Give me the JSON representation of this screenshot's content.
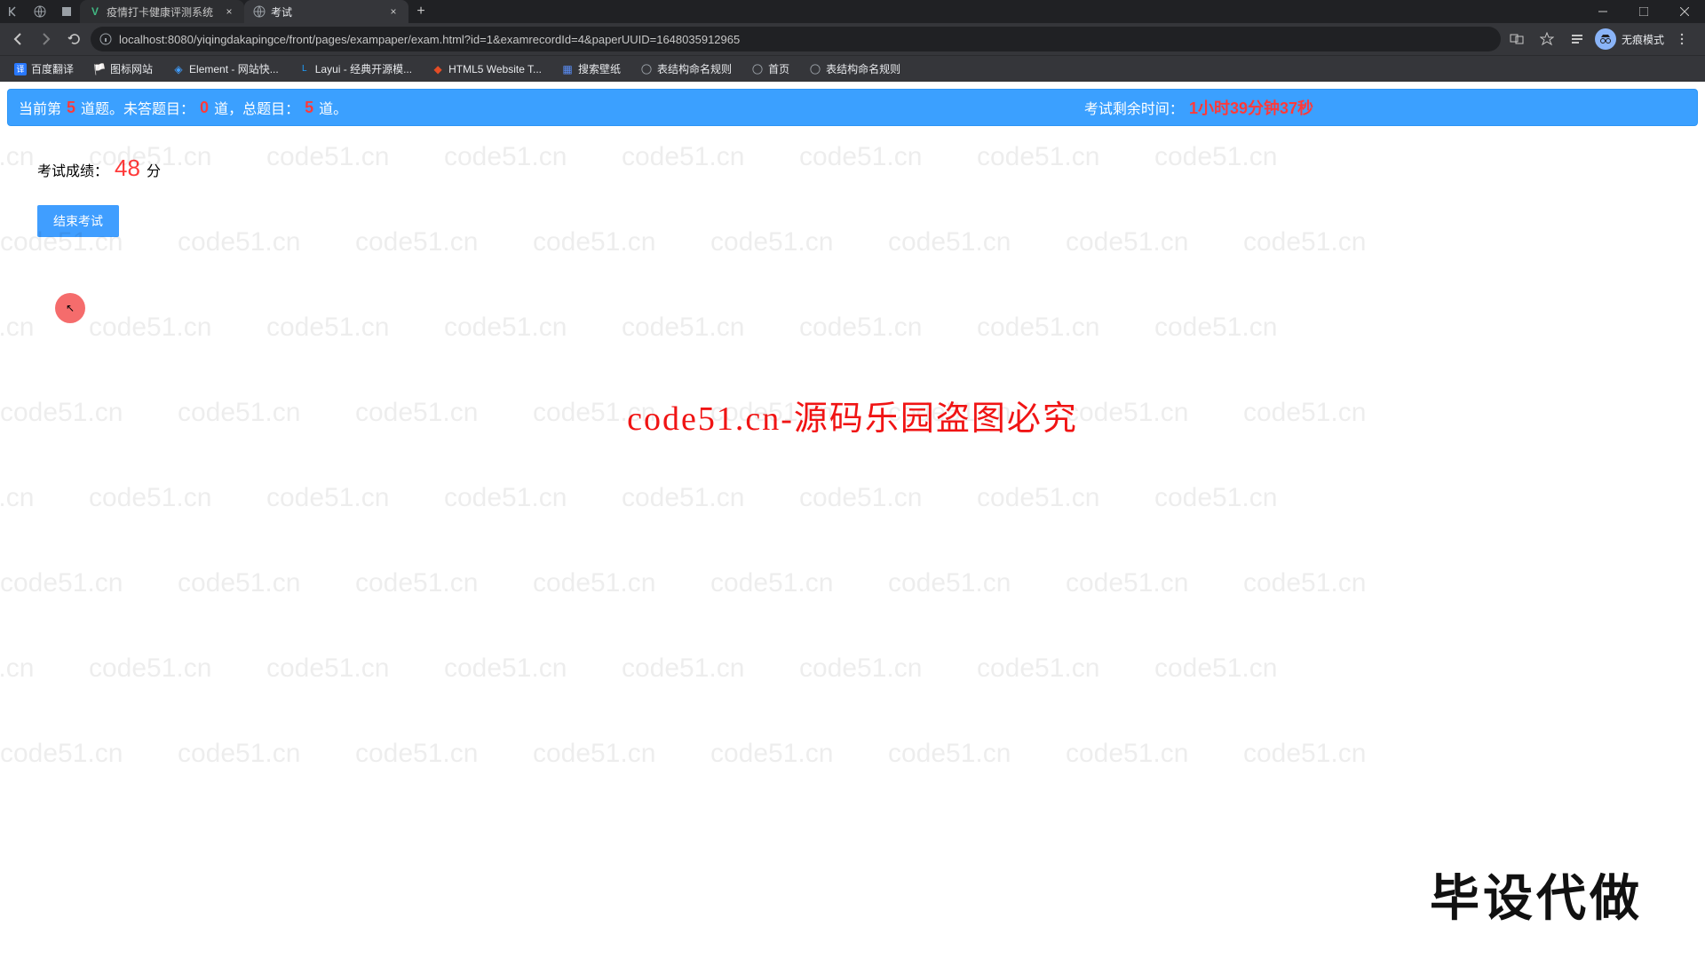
{
  "browser": {
    "tabs": [
      {
        "title": "疫情打卡健康评测系统",
        "favicon": "V"
      },
      {
        "title": "考试",
        "favicon": "globe"
      }
    ],
    "url": "localhost:8080/yiqingdakapingce/front/pages/exampaper/exam.html?id=1&examrecordId=4&paperUUID=1648035912965",
    "incognito_label": "无痕模式"
  },
  "bookmarks": [
    {
      "label": "百度翻译"
    },
    {
      "label": "图标网站"
    },
    {
      "label": "Element - 网站快..."
    },
    {
      "label": "Layui - 经典开源模..."
    },
    {
      "label": "HTML5 Website T..."
    },
    {
      "label": "搜索壁纸"
    },
    {
      "label": "表结构命名规则"
    },
    {
      "label": "首页"
    },
    {
      "label": "表结构命名规则"
    }
  ],
  "exam_header": {
    "current_prefix": "当前第",
    "current_num": "5",
    "current_suffix": "道题。未答题目：",
    "unanswered_num": "0",
    "unanswered_suffix": "道，总题目：",
    "total_num": "5",
    "total_suffix": "道。",
    "time_label": "考试剩余时间：",
    "time_value": "1小时39分钟37秒"
  },
  "score": {
    "label": "考试成绩：",
    "value": "48",
    "unit": "分"
  },
  "end_button": "结束考试",
  "watermark_text": "code51.cn",
  "center_text": "code51.cn-源码乐园盗图必究",
  "corner_text": "毕设代做"
}
